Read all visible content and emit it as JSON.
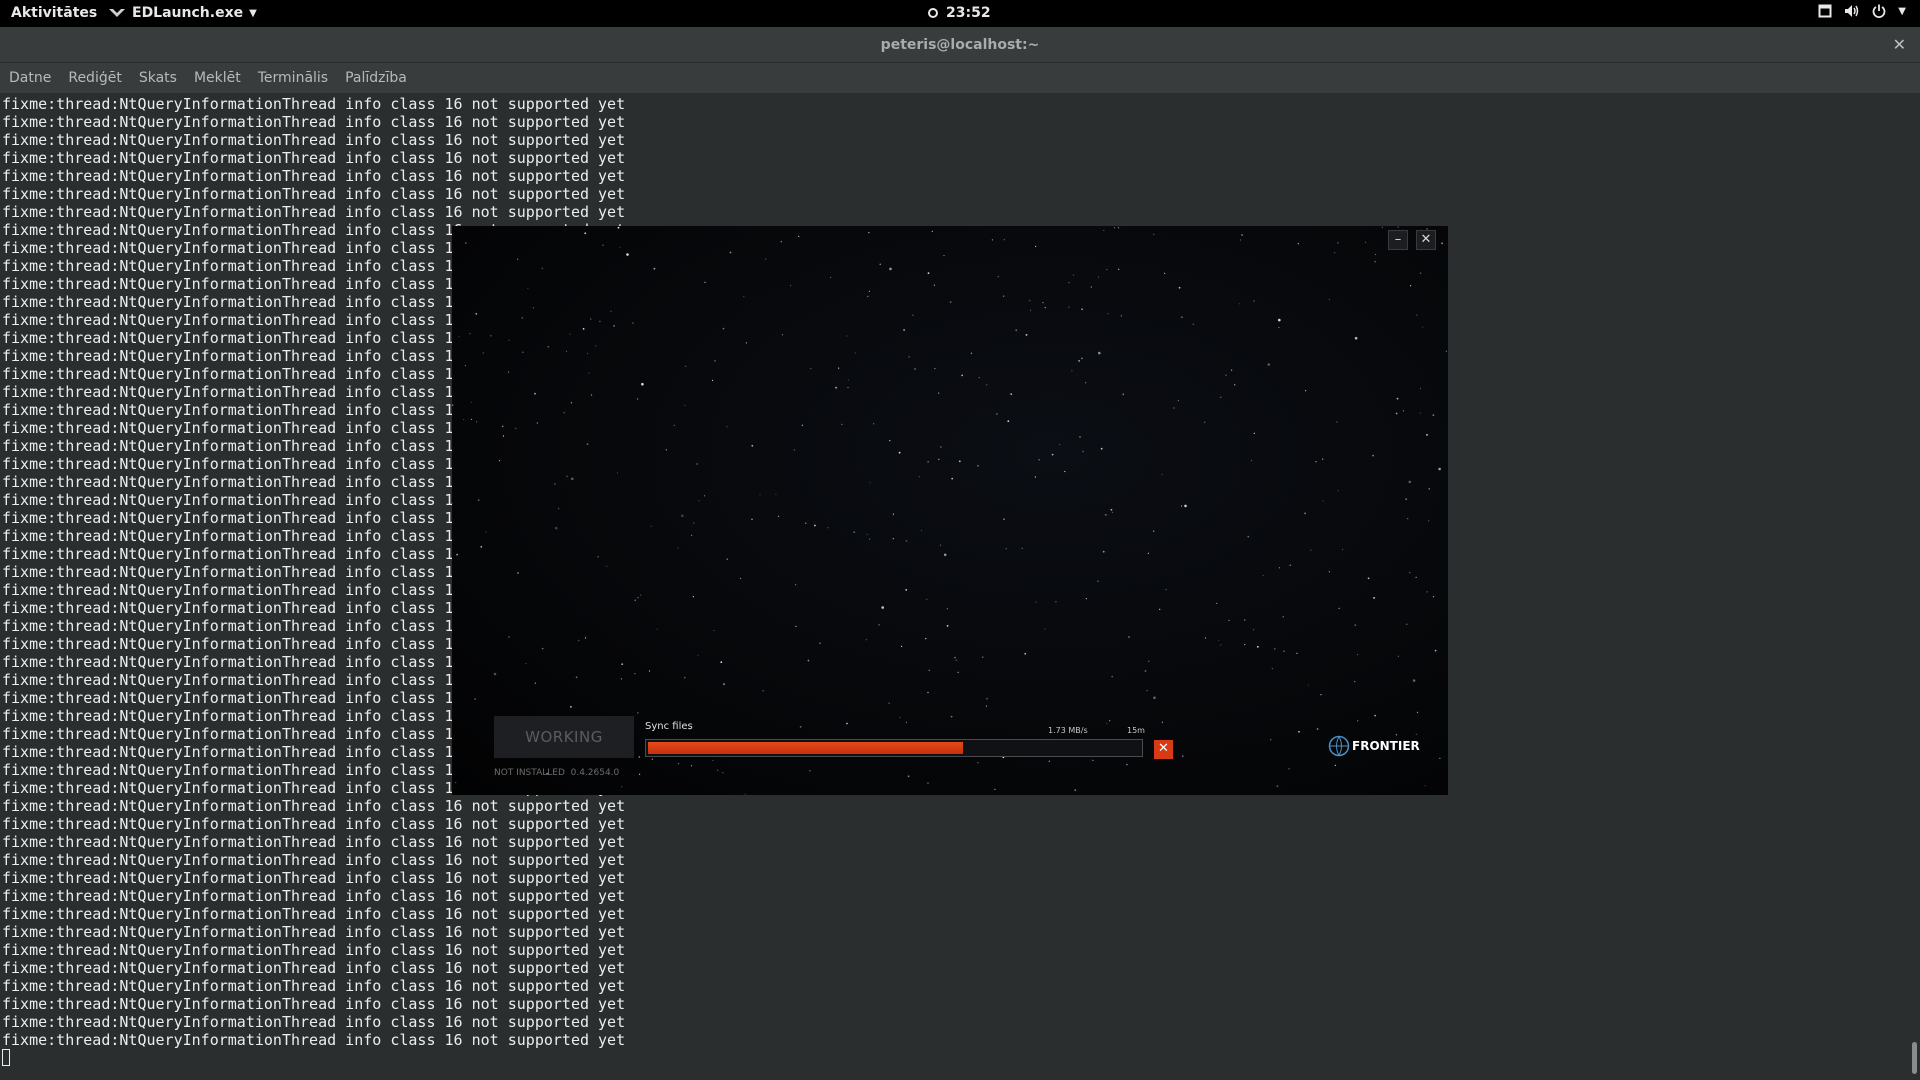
{
  "topbar": {
    "activities": "Aktivitātes",
    "app_name": "EDLaunch.exe",
    "clock": "23:52"
  },
  "terminal": {
    "title": "peteris@localhost:~",
    "menu": [
      "Datne",
      "Rediģēt",
      "Skats",
      "Meklēt",
      "Terminālis",
      "Palīdzība"
    ],
    "line_text": "fixme:thread:NtQueryInformationThread info class 16 not supported yet",
    "line_count": 53
  },
  "launcher": {
    "working_label": "WORKING",
    "sync_label": "Sync files",
    "speed": "1.73 MB/s",
    "eta": "15m",
    "progress": 0.64,
    "status_text": "NOT INSTALLED",
    "version": "0.4.2654.0",
    "brand": "FRONTIER",
    "colors": {
      "accent": "#d93a16"
    }
  }
}
